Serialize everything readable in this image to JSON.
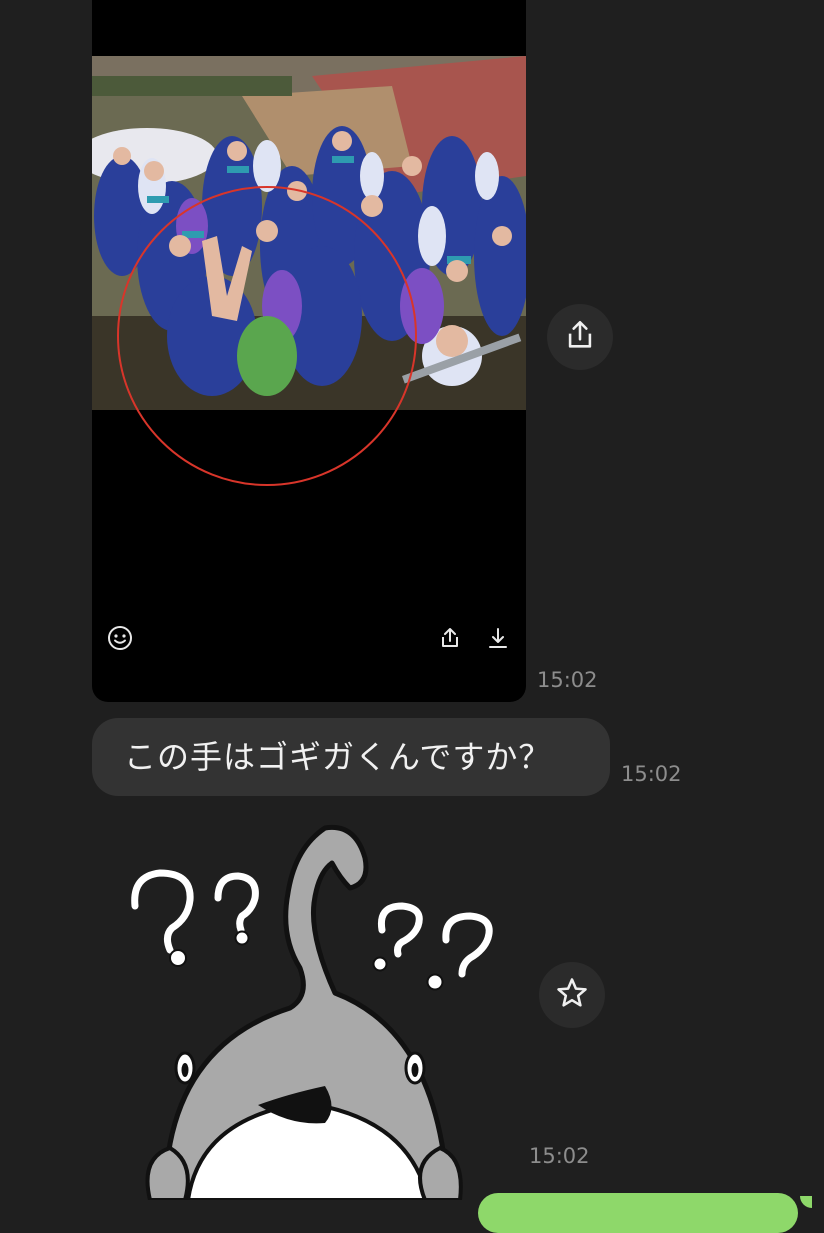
{
  "messages": [
    {
      "type": "image",
      "time": "15:02"
    },
    {
      "type": "text",
      "text": "この手はゴギガくんですか？",
      "time": "15:02"
    },
    {
      "type": "sticker",
      "time": "15:02"
    }
  ],
  "icons": {
    "reaction": "smiley-icon",
    "card_share": "share-icon",
    "card_download": "download-icon",
    "side_share": "share-icon",
    "favorite": "star-icon"
  },
  "colors": {
    "background": "#1f1f1f",
    "bubble": "#333333",
    "highlight_circle": "#d8352a",
    "own_bubble": "#8ed86a"
  }
}
